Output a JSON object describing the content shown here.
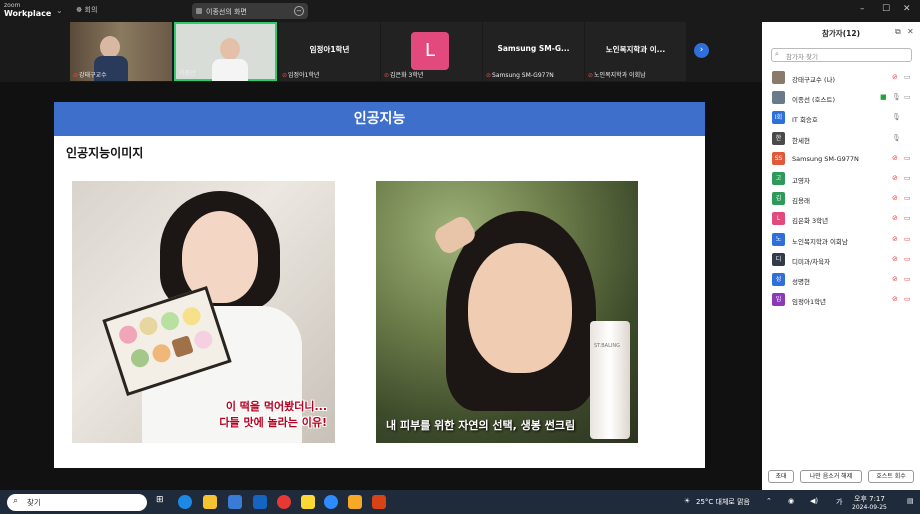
{
  "app": {
    "logo_line1": "zoom",
    "logo_line2": "Workplace",
    "meeting_label": "회의"
  },
  "share_pill": {
    "label": "이종선의 화면"
  },
  "tiles": [
    {
      "name": "강태구교수"
    },
    {
      "name": "이종선"
    },
    {
      "name": "임정아1학년",
      "center": "임정아1학년"
    },
    {
      "name": "김은화 3학년",
      "avatar_letter": "L"
    },
    {
      "name": "Samsung SM-G977N",
      "center": "Samsung  SM-G..."
    },
    {
      "name": "노인복지학과 이회남",
      "center": "노인복지학과  이..."
    }
  ],
  "slide": {
    "title": "인공지능",
    "subtitle": "인공지능이미지",
    "caption_left_line1": "이 떡을 먹어봤더니...",
    "caption_left_line2": "다들 맛에 놀라는 이유!",
    "caption_right": "내 피부를 위한 자연의 선택, 생봉 썬크림",
    "tube_label": "ST.BALING"
  },
  "panel": {
    "title": "참가자(12)",
    "search_placeholder": "참가자 찾기",
    "participants": [
      {
        "initial": "",
        "name": "강태구교수 (나)",
        "color": "#8a7a6a"
      },
      {
        "initial": "",
        "name": "이종선 (호스트)",
        "color": "#6a7a8a"
      },
      {
        "initial": "I회",
        "name": "IT 회승호",
        "color": "#2f6fdc"
      },
      {
        "initial": "한",
        "name": "한세현",
        "color": "#4a4a4a"
      },
      {
        "initial": "SS",
        "name": "Samsung SM-G977N",
        "color": "#e05a3a"
      },
      {
        "initial": "고",
        "name": "고영자",
        "color": "#2e9a5a"
      },
      {
        "initial": "김",
        "name": "김용래",
        "color": "#2e9a5a"
      },
      {
        "initial": "L",
        "name": "김은화 3학년",
        "color": "#e24a7e"
      },
      {
        "initial": "노",
        "name": "노인복지학과 이회남",
        "color": "#2f6fdc"
      },
      {
        "initial": "디",
        "name": "디미과/차육자",
        "color": "#333a4a"
      },
      {
        "initial": "성",
        "name": "성명현",
        "color": "#2f6fdc"
      },
      {
        "initial": "임",
        "name": "임정아1학년",
        "color": "#8a3ab8"
      }
    ],
    "btn_invite": "초대",
    "btn_unmute": "나만 음소거 해제",
    "btn_claim": "호스트 회수"
  },
  "taskbar": {
    "search": "찾기",
    "weather": "25°C 대체로 맑음",
    "time": "오후 7:17",
    "date": "2024-09-25",
    "lang": "가"
  }
}
